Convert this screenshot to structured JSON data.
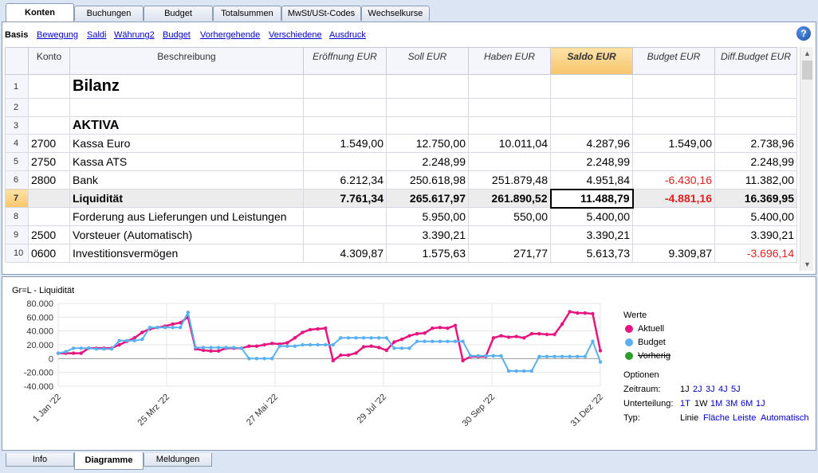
{
  "tabs": [
    "Konten",
    "Buchungen",
    "Budget",
    "Totalsummen",
    "MwSt/USt-Codes",
    "Wechselkurse"
  ],
  "subtabs": {
    "active": "Basis",
    "links": [
      "Bewegung",
      "Saldi",
      "Währung2",
      "Budget",
      "Vorhergehende",
      "Verschiedene",
      "Ausdruck"
    ]
  },
  "help_label": "?",
  "columns": [
    "Konto",
    "Beschreibung",
    "Eröffnung EUR",
    "Soll EUR",
    "Haben EUR",
    "Saldo EUR",
    "Budget EUR",
    "Diff.Budget EUR"
  ],
  "rows": [
    {
      "n": "1",
      "konto": "",
      "desc": "Bilanz",
      "eroeffnung": "",
      "soll": "",
      "haben": "",
      "saldo": "",
      "budget": "",
      "diff": ""
    },
    {
      "n": "2",
      "konto": "",
      "desc": "",
      "eroeffnung": "",
      "soll": "",
      "haben": "",
      "saldo": "",
      "budget": "",
      "diff": ""
    },
    {
      "n": "3",
      "konto": "",
      "desc": "AKTIVA",
      "eroeffnung": "",
      "soll": "",
      "haben": "",
      "saldo": "",
      "budget": "",
      "diff": ""
    },
    {
      "n": "4",
      "konto": "2700",
      "desc": "Kassa Euro",
      "eroeffnung": "1.549,00",
      "soll": "12.750,00",
      "haben": "10.011,04",
      "saldo": "4.287,96",
      "budget": "1.549,00",
      "diff": "2.738,96"
    },
    {
      "n": "5",
      "konto": "2750",
      "desc": "Kassa ATS",
      "eroeffnung": "",
      "soll": "2.248,99",
      "haben": "",
      "saldo": "2.248,99",
      "budget": "",
      "diff": "2.248,99"
    },
    {
      "n": "6",
      "konto": "2800",
      "desc": "Bank",
      "eroeffnung": "6.212,34",
      "soll": "250.618,98",
      "haben": "251.879,48",
      "saldo": "4.951,84",
      "budget": "-6.430,16",
      "diff": "11.382,00"
    },
    {
      "n": "7",
      "konto": "",
      "desc": "Liquidität",
      "eroeffnung": "7.761,34",
      "soll": "265.617,97",
      "haben": "261.890,52",
      "saldo": "11.488,79",
      "budget": "-4.881,16",
      "diff": "16.369,95"
    },
    {
      "n": "8",
      "konto": "",
      "desc": "Forderung aus Lieferungen und Leistungen",
      "eroeffnung": "",
      "soll": "5.950,00",
      "haben": "550,00",
      "saldo": "5.400,00",
      "budget": "",
      "diff": "5.400,00"
    },
    {
      "n": "9",
      "konto": "2500",
      "desc": "Vorsteuer (Automatisch)",
      "eroeffnung": "",
      "soll": "3.390,21",
      "haben": "",
      "saldo": "3.390,21",
      "budget": "",
      "diff": "3.390,21"
    },
    {
      "n": "10",
      "konto": "0600",
      "desc": "Investitionsvermögen",
      "eroeffnung": "4.309,87",
      "soll": "1.575,63",
      "haben": "271,77",
      "saldo": "5.613,73",
      "budget": "9.309,87",
      "diff": "-3.696,14"
    }
  ],
  "legend": {
    "werte_title": "Werte",
    "series_labels": [
      "Aktuell",
      "Budget",
      "Vorherig"
    ],
    "optionen_title": "Optionen",
    "zeitraum_label": "Zeitraum:",
    "zeitraum_options": [
      "1J",
      "2J",
      "3J",
      "4J",
      "5J"
    ],
    "unterteilung_label": "Unterteilung:",
    "unterteilung_options": [
      "1T",
      "1W",
      "1M",
      "3M",
      "6M",
      "1J"
    ],
    "typ_label": "Typ:",
    "typ_options": [
      "Linie",
      "Fläche",
      "Leiste",
      "Automatisch"
    ]
  },
  "colors": {
    "aktuell": "#e6157f",
    "budget": "#5ab0ef",
    "vorherig": "#2aa02a",
    "negative": "#e02020",
    "highlight": "#f7c46a"
  },
  "bottom_tabs": [
    "Info",
    "Diagramme",
    "Meldungen"
  ],
  "chart_data": {
    "type": "line",
    "title": "Gr=L - Liquidität",
    "x_ticks": [
      "1 Jan '22",
      "25 Mrz '22",
      "27 Mai '22",
      "29 Jul '22",
      "30 Sep '22",
      "31 Dez '22"
    ],
    "x_start": "2022-01-01",
    "x_end": "2022-12-31",
    "ylim": [
      -40000,
      80000
    ],
    "y_ticks": [
      "80.000",
      "60.000",
      "40.000",
      "20.000",
      "0",
      "-20.000",
      "-40.000"
    ],
    "y_tick_values": [
      80000,
      60000,
      40000,
      20000,
      0,
      -20000,
      -40000
    ],
    "grid": true,
    "series": [
      {
        "name": "Aktuell",
        "color": "#e6157f",
        "values": [
          7761,
          7761,
          7761,
          7761,
          15000,
          15000,
          15000,
          15000,
          20000,
          25000,
          30000,
          38000,
          43000,
          45000,
          47000,
          50000,
          52000,
          60000,
          14000,
          12000,
          11000,
          11000,
          15000,
          15000,
          15000,
          18000,
          18000,
          20000,
          22000,
          21000,
          23000,
          30000,
          38000,
          42000,
          43000,
          44000,
          -3000,
          5000,
          5000,
          8000,
          17000,
          18000,
          16000,
          12000,
          24000,
          28000,
          33000,
          36000,
          37000,
          44000,
          45000,
          44000,
          48000,
          -3000,
          3000,
          3000,
          3000,
          30000,
          33000,
          31000,
          32000,
          30000,
          36000,
          36000,
          35000,
          35000,
          50000,
          68000,
          66000,
          66000,
          65000,
          11489
        ]
      },
      {
        "name": "Budget",
        "color": "#5ab0ef",
        "values": [
          7761,
          10000,
          15000,
          15000,
          15000,
          14000,
          14000,
          14000,
          26000,
          26000,
          26000,
          28000,
          45000,
          45000,
          45000,
          45000,
          45000,
          67000,
          16000,
          16000,
          16000,
          16000,
          16000,
          16000,
          15000,
          0,
          0,
          0,
          0,
          18000,
          18000,
          18000,
          20000,
          20000,
          20000,
          20000,
          20000,
          30000,
          30000,
          30000,
          30000,
          30000,
          30000,
          30000,
          15000,
          15000,
          15000,
          25000,
          25000,
          25000,
          25000,
          25000,
          25000,
          25000,
          4000,
          4000,
          4000,
          4000,
          4000,
          -18000,
          -18000,
          -18000,
          -18000,
          3000,
          3000,
          3000,
          3000,
          3000,
          3000,
          3000,
          25000,
          -4881
        ]
      },
      {
        "name": "Vorherig",
        "color": "#2aa02a",
        "values": []
      }
    ]
  }
}
